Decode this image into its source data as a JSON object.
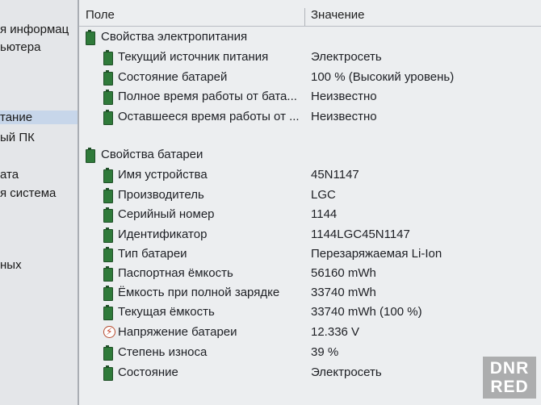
{
  "sidebar": {
    "items": [
      {
        "label": "я информац"
      },
      {
        "label": "ьютера"
      },
      {
        "label": "тание"
      },
      {
        "label": "ый ПК"
      },
      {
        "label": "ата"
      },
      {
        "label": "я система"
      },
      {
        "label": "ных"
      }
    ]
  },
  "table": {
    "headers": {
      "field": "Поле",
      "value": "Значение"
    },
    "groups": [
      {
        "title": "Свойства электропитания",
        "rows": [
          {
            "name": "Текущий источник питания",
            "value": "Электросеть"
          },
          {
            "name": "Состояние батарей",
            "value": "100 % (Высокий уровень)"
          },
          {
            "name": "Полное время работы от бата...",
            "value": "Неизвестно"
          },
          {
            "name": "Оставшееся время работы от ...",
            "value": "Неизвестно"
          }
        ]
      },
      {
        "title": "Свойства батареи",
        "rows": [
          {
            "name": "Имя устройства",
            "value": "45N1147"
          },
          {
            "name": "Производитель",
            "value": "LGC"
          },
          {
            "name": "Серийный номер",
            "value": "1144"
          },
          {
            "name": "Идентификатор",
            "value": "1144LGC45N1147"
          },
          {
            "name": "Тип батареи",
            "value": "Перезаряжаемая Li-Ion"
          },
          {
            "name": "Паспортная ёмкость",
            "value": "56160 mWh"
          },
          {
            "name": "Ёмкость при полной зарядке",
            "value": "33740 mWh"
          },
          {
            "name": "Текущая ёмкость",
            "value": "33740 mWh  (100 %)"
          },
          {
            "name": "Напряжение батареи",
            "value": "12.336 V"
          },
          {
            "name": "Степень износа",
            "value": "39 %"
          },
          {
            "name": "Состояние",
            "value": "Электросеть"
          }
        ]
      }
    ]
  },
  "watermark": {
    "line1": "DNR",
    "line2": "RED"
  }
}
